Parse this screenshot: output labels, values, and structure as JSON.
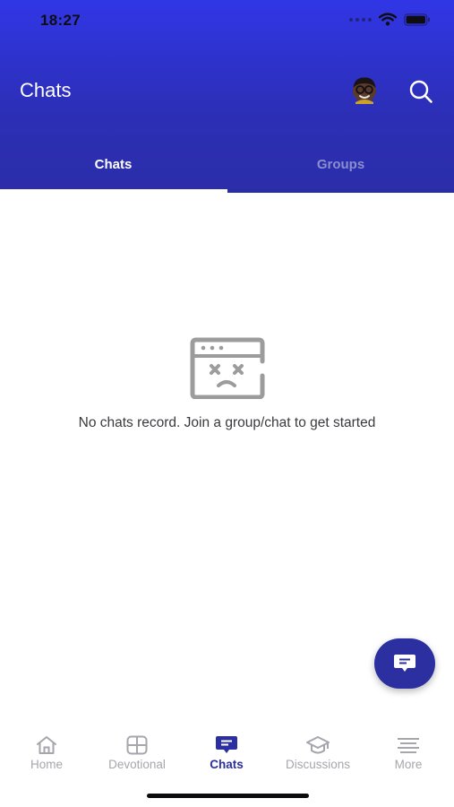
{
  "status_bar": {
    "time": "18:27"
  },
  "header": {
    "title": "Chats",
    "tabs": [
      {
        "label": "Chats",
        "active": true
      },
      {
        "label": "Groups",
        "active": false
      }
    ]
  },
  "empty_state": {
    "icon": "sad-browser-window-icon",
    "message": "No chats record. Join a group/chat to get started"
  },
  "fab": {
    "icon": "new-chat-icon"
  },
  "bottom_nav": {
    "items": [
      {
        "label": "Home",
        "icon": "home-icon",
        "active": false
      },
      {
        "label": "Devotional",
        "icon": "grid-icon",
        "active": false
      },
      {
        "label": "Chats",
        "icon": "chat-icon",
        "active": true
      },
      {
        "label": "Discussions",
        "icon": "graduation-cap-icon",
        "active": false
      },
      {
        "label": "More",
        "icon": "menu-lines-icon",
        "active": false
      }
    ]
  },
  "colors": {
    "header_top": "#3136e6",
    "header_bottom": "#2b2da8",
    "accent": "#2b2f9f",
    "inactive": "#a6a6ac"
  }
}
